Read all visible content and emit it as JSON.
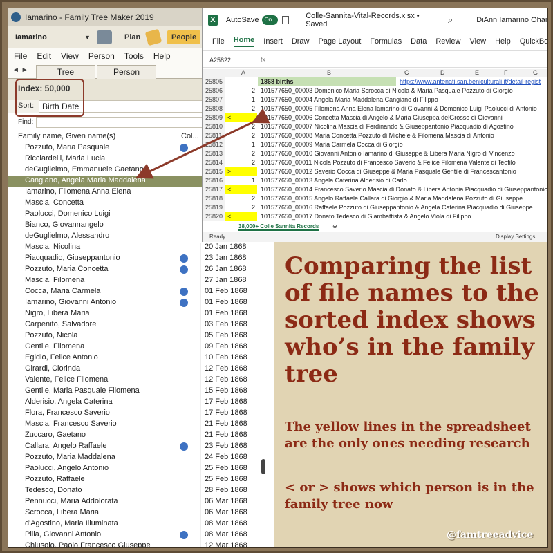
{
  "ftm": {
    "title": "Iamarino - Family Tree Maker 2019",
    "toolbar": {
      "user": "Iamarino",
      "plan": "Plan",
      "people": "People"
    },
    "menu": [
      "File",
      "Edit",
      "View",
      "Person",
      "Tools",
      "Help"
    ],
    "tabs": [
      "Tree",
      "Person"
    ],
    "index_label": "Index: 50,000",
    "sort_label": "Sort:",
    "sort_value": "Birth Date",
    "find_label": "Find:",
    "list_header": {
      "name_col": "Family name, Given name(s)",
      "second_col": "Col..."
    },
    "rows": [
      {
        "name": "Pozzuto, Maria Pasquale",
        "dot": true,
        "date": ""
      },
      {
        "name": "Ricciardelli, Maria Lucia",
        "dot": false,
        "date": ""
      },
      {
        "name": "deGuglielmo, Emmanuele Gaetano",
        "dot": false,
        "date": ""
      },
      {
        "name": "Cangiano, Angela Maria Maddalena",
        "dot": false,
        "date": "",
        "selected": true
      },
      {
        "name": "Iamarino, Filomena Anna Elena",
        "dot": false,
        "date": ""
      },
      {
        "name": "Mascia, Concetta",
        "dot": false,
        "date": ""
      },
      {
        "name": "Paolucci, Domenico Luigi",
        "dot": false,
        "date": ""
      },
      {
        "name": "Bianco, Giovannangelo",
        "dot": false,
        "date": ""
      },
      {
        "name": "deGuglielmo, Alessandro",
        "dot": false,
        "date": ""
      },
      {
        "name": "Mascia, Nicolina",
        "dot": false,
        "date": "20 Jan 1868"
      },
      {
        "name": "Piacquadio, Giuseppantonio",
        "dot": true,
        "date": "23 Jan 1868"
      },
      {
        "name": "Pozzuto, Maria Concetta",
        "dot": true,
        "date": "26 Jan 1868"
      },
      {
        "name": "Mascia, Filomena",
        "dot": false,
        "date": "27 Jan 1868"
      },
      {
        "name": "Cocca, Maria Carmela",
        "dot": true,
        "date": "01 Feb 1868"
      },
      {
        "name": "Iamarino, Giovanni Antonio",
        "dot": true,
        "date": "01 Feb 1868"
      },
      {
        "name": "Nigro, Libera Maria",
        "dot": false,
        "date": "01 Feb 1868"
      },
      {
        "name": "Carpenito, Salvadore",
        "dot": false,
        "date": "03 Feb 1868"
      },
      {
        "name": "Pozzuto, Nicola",
        "dot": false,
        "date": "05 Feb 1868"
      },
      {
        "name": "Gentile, Filomena",
        "dot": false,
        "date": "09 Feb 1868"
      },
      {
        "name": "Egidio, Felice Antonio",
        "dot": false,
        "date": "10 Feb 1868"
      },
      {
        "name": "Girardi, Clorinda",
        "dot": false,
        "date": "12 Feb 1868"
      },
      {
        "name": "Valente, Felice Filomena",
        "dot": false,
        "date": "12 Feb 1868"
      },
      {
        "name": "Gentile, Maria Pasquale Filomena",
        "dot": false,
        "date": "15 Feb 1868"
      },
      {
        "name": "Alderisio, Angela Caterina",
        "dot": false,
        "date": "17 Feb 1868"
      },
      {
        "name": "Flora, Francesco Saverio",
        "dot": false,
        "date": "17 Feb 1868"
      },
      {
        "name": "Mascia, Francesco Saverio",
        "dot": false,
        "date": "21 Feb 1868"
      },
      {
        "name": "Zuccaro, Gaetano",
        "dot": false,
        "date": "21 Feb 1868"
      },
      {
        "name": "Callara, Angelo Raffaele",
        "dot": true,
        "date": "23 Feb 1868"
      },
      {
        "name": "Pozzuto, Maria Maddalena",
        "dot": false,
        "date": "24 Feb 1868"
      },
      {
        "name": "Paolucci, Angelo Antonio",
        "dot": false,
        "date": "25 Feb 1868"
      },
      {
        "name": "Pozzuto, Raffaele",
        "dot": false,
        "date": "25 Feb 1868"
      },
      {
        "name": "Tedesco, Donato",
        "dot": false,
        "date": "28 Feb 1868"
      },
      {
        "name": "Pennucci, Maria Addolorata",
        "dot": false,
        "date": "06 Mar 1868"
      },
      {
        "name": "Scrocca, Libera Maria",
        "dot": false,
        "date": "06 Mar 1868"
      },
      {
        "name": "d'Agostino, Maria Illuminata",
        "dot": false,
        "date": "08 Mar 1868"
      },
      {
        "name": "Pilla, Giovanni Antonio",
        "dot": true,
        "date": "08 Mar 1868"
      },
      {
        "name": "Chiusolo, Paolo Francesco Giuseppe",
        "dot": false,
        "date": "12 Mar 1868"
      }
    ]
  },
  "excel": {
    "logo": "X",
    "autosave": "AutoSave",
    "toggle": "On",
    "filename": "Colle-Sannita-Vital-Records.xlsx • Saved",
    "user": "DiAnn Iamarino Ohan",
    "ribbon": [
      "File",
      "Home",
      "Insert",
      "Draw",
      "Page Layout",
      "Formulas",
      "Data",
      "Review",
      "View",
      "Help",
      "QuickBooks"
    ],
    "cell_ref": "A25822",
    "fx": "fx",
    "columns": [
      "A",
      "B",
      "C",
      "D",
      "E",
      "F",
      "G"
    ],
    "rows": [
      {
        "n": "25805",
        "a": "",
        "b": "1868 births",
        "url": "https://www.antenati.san.beniculturali.it/detail-regist"
      },
      {
        "n": "25806",
        "a": "2",
        "b": "101577650_00003 Domenico Maria Scrocca di Nicola & Maria Pasquale Pozzuto di Giorgio"
      },
      {
        "n": "25807",
        "a": "1",
        "b": "101577650_00004 Angela Maria Maddalena Cangiano di Filippo"
      },
      {
        "n": "25808",
        "a": "2",
        "b": "101577650_00005 Filomena Anna Elena Iamarino di Giovanni & Domenico Luigi Paolucci di Antonio"
      },
      {
        "n": "25809",
        "a": "<",
        "b": "101577650_00006 Concetta Mascia di Angelo & Maria Giuseppa delGrosso di Giovanni",
        "yellow": true
      },
      {
        "n": "25810",
        "a": "2",
        "b": "101577650_00007 Nicolina Mascia di Ferdinando & Giuseppantonio Piacquadio di Agostino"
      },
      {
        "n": "25811",
        "a": "2",
        "b": "101577650_00008 Maria Concetta Pozzuto di Michele & Filomena Mascia di Antonio"
      },
      {
        "n": "25812",
        "a": "1",
        "b": "101577650_00009 Maria Carmela Cocca di Giorgio"
      },
      {
        "n": "25813",
        "a": "2",
        "b": "101577650_00010 Giovanni Antonio Iamarino di Giuseppe & Libera Maria Nigro di Vincenzo"
      },
      {
        "n": "25814",
        "a": "2",
        "b": "101577650_00011 Nicola Pozzuto di Francesco Saverio & Felice Filomena Valente di Teofilo"
      },
      {
        "n": "25815",
        "a": ">",
        "b": "101577650_00012 Saverio Cocca di Giuseppe & Maria Pasquale Gentile di Francescantonio",
        "yellow": true
      },
      {
        "n": "25816",
        "a": "1",
        "b": "101577650_00013 Angela Caterina Alderisio di Carlo"
      },
      {
        "n": "25817",
        "a": "<",
        "b": "101577650_00014 Francesco Saverio Mascia di Donato & Libera Antonia Piacquadio di Giuseppantonio",
        "yellow": true
      },
      {
        "n": "25818",
        "a": "2",
        "b": "101577650_00015 Angelo Raffaele Callara di Giorgio & Maria Maddalena Pozzuto di Giuseppe"
      },
      {
        "n": "25819",
        "a": "2",
        "b": "101577650_00016 Raffaele Pozzuto di Giuseppantonio & Angela Caterina Piacquadio di Giuseppe"
      },
      {
        "n": "25820",
        "a": "<",
        "b": "101577650_00017 Donato Tedesco di Giambattista & Angelo Viola di Filippo",
        "yellow": true
      }
    ],
    "sheet_tab": "38,000+ Colle Sannita Records",
    "status_ready": "Ready",
    "display_settings": "Display Settings"
  },
  "annotation": {
    "headline": "Comparing the list of file names to the sorted index shows who’s in the family tree",
    "note1": "The yellow lines in the spreadsheet are the only ones needing research",
    "note2": "< or > shows which person is in the family tree now",
    "credit": "@famtreeadvice",
    "text_color": "#8c2a15",
    "panel_color": "#e1d4b3",
    "arrow_color": "#8c3a2a"
  }
}
